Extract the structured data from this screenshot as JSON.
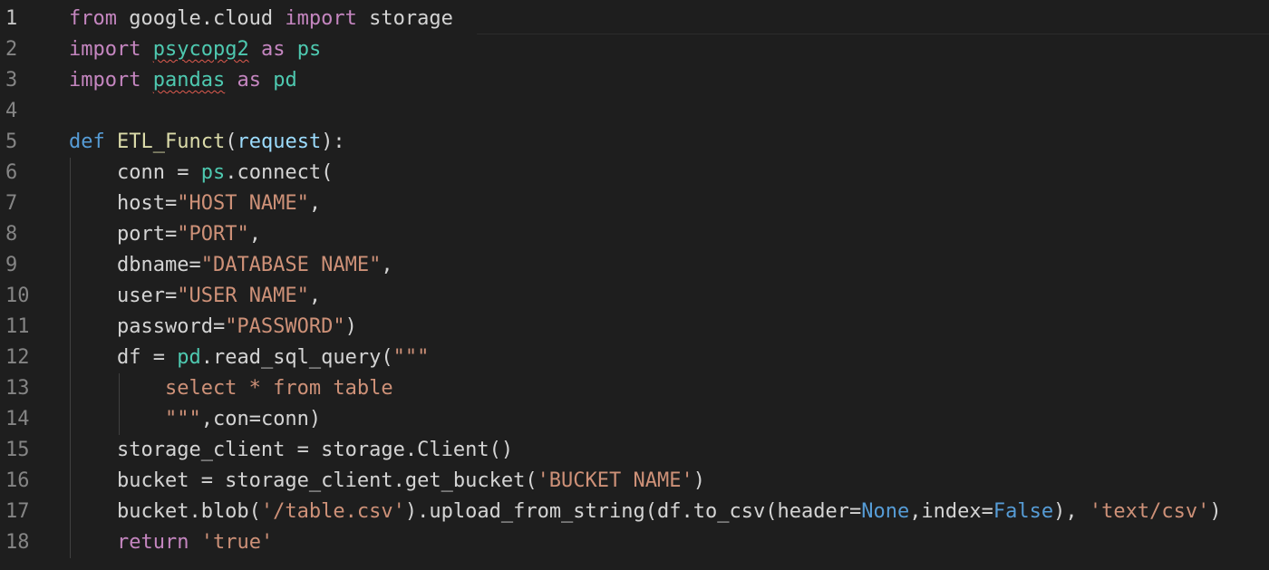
{
  "editor": {
    "line_numbers": [
      "1",
      "2",
      "3",
      "4",
      "5",
      "6",
      "7",
      "8",
      "9",
      "10",
      "11",
      "12",
      "13",
      "14",
      "15",
      "16",
      "17",
      "18"
    ],
    "active_line": "1",
    "lines": [
      [
        {
          "t": "from",
          "c": "kw"
        },
        {
          "t": " google.cloud ",
          "c": "plain"
        },
        {
          "t": "import",
          "c": "kw"
        },
        {
          "t": " storage",
          "c": "plain"
        }
      ],
      [
        {
          "t": "import",
          "c": "kw"
        },
        {
          "t": " ",
          "c": "plain"
        },
        {
          "t": "psycopg2",
          "c": "mod squig"
        },
        {
          "t": " ",
          "c": "plain"
        },
        {
          "t": "as",
          "c": "kw"
        },
        {
          "t": " ",
          "c": "plain"
        },
        {
          "t": "ps",
          "c": "mod"
        }
      ],
      [
        {
          "t": "import",
          "c": "kw"
        },
        {
          "t": " ",
          "c": "plain"
        },
        {
          "t": "pandas",
          "c": "mod squig"
        },
        {
          "t": " ",
          "c": "plain"
        },
        {
          "t": "as",
          "c": "kw"
        },
        {
          "t": " ",
          "c": "plain"
        },
        {
          "t": "pd",
          "c": "mod"
        }
      ],
      [],
      [
        {
          "t": "def",
          "c": "def"
        },
        {
          "t": " ",
          "c": "plain"
        },
        {
          "t": "ETL_Funct",
          "c": "fn"
        },
        {
          "t": "(",
          "c": "plain"
        },
        {
          "t": "request",
          "c": "id"
        },
        {
          "t": "):",
          "c": "plain"
        }
      ],
      [
        {
          "t": "    conn = ",
          "c": "plain"
        },
        {
          "t": "ps",
          "c": "mod"
        },
        {
          "t": ".connect(",
          "c": "plain"
        }
      ],
      [
        {
          "t": "    host=",
          "c": "plain"
        },
        {
          "t": "\"HOST NAME\"",
          "c": "str"
        },
        {
          "t": ",",
          "c": "plain"
        }
      ],
      [
        {
          "t": "    port=",
          "c": "plain"
        },
        {
          "t": "\"PORT\"",
          "c": "str"
        },
        {
          "t": ",",
          "c": "plain"
        }
      ],
      [
        {
          "t": "    dbname=",
          "c": "plain"
        },
        {
          "t": "\"DATABASE NAME\"",
          "c": "str"
        },
        {
          "t": ",",
          "c": "plain"
        }
      ],
      [
        {
          "t": "    user=",
          "c": "plain"
        },
        {
          "t": "\"USER NAME\"",
          "c": "str"
        },
        {
          "t": ",",
          "c": "plain"
        }
      ],
      [
        {
          "t": "    password=",
          "c": "plain"
        },
        {
          "t": "\"PASSWORD\"",
          "c": "str"
        },
        {
          "t": ")",
          "c": "plain"
        }
      ],
      [
        {
          "t": "    df = ",
          "c": "plain"
        },
        {
          "t": "pd",
          "c": "mod"
        },
        {
          "t": ".read_sql_query(",
          "c": "plain"
        },
        {
          "t": "\"\"\"",
          "c": "str"
        }
      ],
      [
        {
          "t": "        select * from table",
          "c": "str"
        }
      ],
      [
        {
          "t": "        ",
          "c": "plain"
        },
        {
          "t": "\"\"\"",
          "c": "str"
        },
        {
          "t": ",con=conn)",
          "c": "plain"
        }
      ],
      [
        {
          "t": "    storage_client = storage.Client()",
          "c": "plain"
        }
      ],
      [
        {
          "t": "    bucket = storage_client.get_bucket(",
          "c": "plain"
        },
        {
          "t": "'BUCKET NAME'",
          "c": "str"
        },
        {
          "t": ")",
          "c": "plain"
        }
      ],
      [
        {
          "t": "    bucket.blob(",
          "c": "plain"
        },
        {
          "t": "'/table.csv'",
          "c": "str"
        },
        {
          "t": ").upload_from_string(df.to_csv(header=",
          "c": "plain"
        },
        {
          "t": "None",
          "c": "def"
        },
        {
          "t": ",index=",
          "c": "plain"
        },
        {
          "t": "False",
          "c": "def"
        },
        {
          "t": "), ",
          "c": "plain"
        },
        {
          "t": "'text/csv'",
          "c": "str"
        },
        {
          "t": ")",
          "c": "plain"
        }
      ],
      [
        {
          "t": "    ",
          "c": "plain"
        },
        {
          "t": "return",
          "c": "kw"
        },
        {
          "t": " ",
          "c": "plain"
        },
        {
          "t": "'true'",
          "c": "str"
        }
      ]
    ]
  }
}
